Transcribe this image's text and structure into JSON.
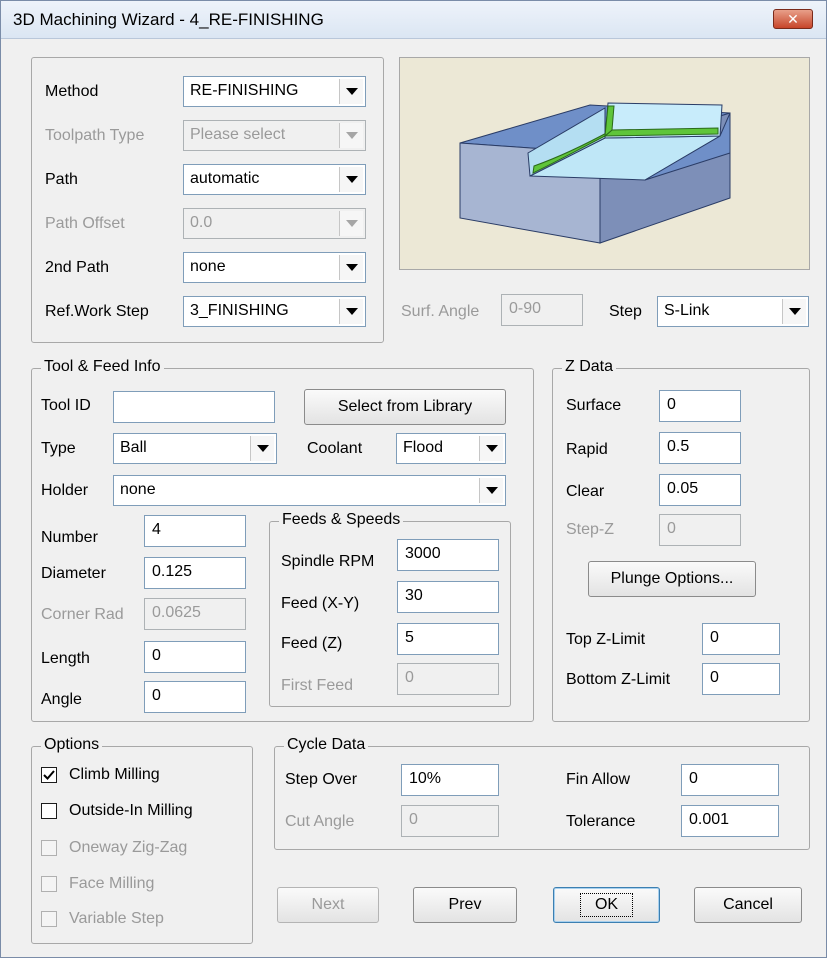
{
  "window": {
    "title": "3D Machining Wizard - 4_RE-FINISHING",
    "close_glyph": "✕"
  },
  "method_panel": {
    "method_label": "Method",
    "method_value": "RE-FINISHING",
    "toolpath_type_label": "Toolpath Type",
    "toolpath_type_value": "Please select",
    "path_label": "Path",
    "path_value": "automatic",
    "path_offset_label": "Path Offset",
    "path_offset_value": "0.0",
    "second_path_label": "2nd Path",
    "second_path_value": "none",
    "ref_work_step_label": "Ref.Work Step",
    "ref_work_step_value": "3_FINISHING"
  },
  "preview": {
    "image": "re-finishing-corner-preview",
    "colors": {
      "background": "#ece8d6",
      "block_top": "#6f8fc8",
      "pocket": "#bfe7f7",
      "tool_path": "#5fc53a"
    }
  },
  "surf_angle": {
    "label": "Surf. Angle",
    "value": "0-90"
  },
  "step": {
    "label": "Step",
    "value": "S-Link"
  },
  "tool_feed": {
    "group_label": "Tool & Feed Info",
    "tool_id_label": "Tool ID",
    "tool_id_value": "",
    "select_library_label": "Select from Library",
    "type_label": "Type",
    "type_value": "Ball",
    "coolant_label": "Coolant",
    "coolant_value": "Flood",
    "holder_label": "Holder",
    "holder_value": "none",
    "number_label": "Number",
    "number_value": "4",
    "diameter_label": "Diameter",
    "diameter_value": "0.125",
    "corner_rad_label": "Corner Rad",
    "corner_rad_value": "0.0625",
    "length_label": "Length",
    "length_value": "0",
    "angle_label": "Angle",
    "angle_value": "0"
  },
  "feeds_speeds": {
    "group_label": "Feeds & Speeds",
    "spindle_rpm_label": "Spindle RPM",
    "spindle_rpm_value": "3000",
    "feed_xy_label": "Feed (X-Y)",
    "feed_xy_value": "30",
    "feed_z_label": "Feed (Z)",
    "feed_z_value": "5",
    "first_feed_label": "First Feed",
    "first_feed_value": "0"
  },
  "z_data": {
    "group_label": "Z Data",
    "surface_label": "Surface",
    "surface_value": "0",
    "rapid_label": "Rapid",
    "rapid_value": "0.5",
    "clear_label": "Clear",
    "clear_value": "0.05",
    "step_z_label": "Step-Z",
    "step_z_value": "0",
    "plunge_options_label": "Plunge Options...",
    "top_z_limit_label": "Top Z-Limit",
    "top_z_limit_value": "0",
    "bottom_z_limit_label": "Bottom Z-Limit",
    "bottom_z_limit_value": "0"
  },
  "options": {
    "group_label": "Options",
    "items": [
      {
        "label": "Climb Milling",
        "checked": true,
        "enabled": true
      },
      {
        "label": "Outside-In Milling",
        "checked": false,
        "enabled": true
      },
      {
        "label": "Oneway Zig-Zag",
        "checked": false,
        "enabled": false
      },
      {
        "label": "Face Milling",
        "checked": false,
        "enabled": false
      },
      {
        "label": "Variable Step",
        "checked": false,
        "enabled": false
      }
    ]
  },
  "cycle_data": {
    "group_label": "Cycle Data",
    "step_over_label": "Step Over",
    "step_over_value": "10%",
    "cut_angle_label": "Cut Angle",
    "cut_angle_value": "0",
    "fin_allow_label": "Fin Allow",
    "fin_allow_value": "0",
    "tolerance_label": "Tolerance",
    "tolerance_value": "0.001"
  },
  "buttons": {
    "next_label": "Next",
    "prev_label": "Prev",
    "ok_label": "OK",
    "cancel_label": "Cancel"
  }
}
